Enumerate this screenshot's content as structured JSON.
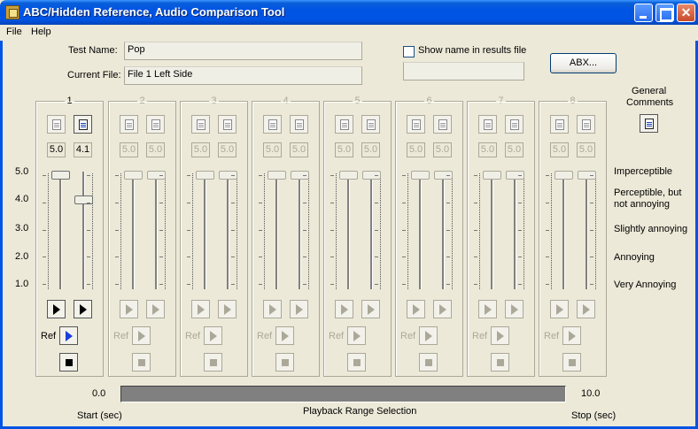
{
  "window": {
    "title": "ABC/Hidden Reference, Audio Comparison Tool"
  },
  "menu": {
    "file": "File",
    "help": "Help"
  },
  "form": {
    "test_name_label": "Test Name:",
    "test_name_value": "Pop",
    "current_file_label": "Current File:",
    "current_file_value": "File 1 Left Side",
    "show_name_label": "Show name in results file",
    "abx_label": "ABX..."
  },
  "general_comments": {
    "line1": "General",
    "line2": "Comments"
  },
  "scale": {
    "ticks": [
      "5.0",
      "4.0",
      "3.0",
      "2.0",
      "1.0"
    ],
    "descriptions": {
      "imperceptible": "Imperceptible",
      "perceptible_1": "Perceptible, but",
      "perceptible_2": "not annoying",
      "slightly": "Slightly annoying",
      "annoying": "Annoying",
      "very": "Very Annoying"
    }
  },
  "channels": [
    {
      "number": "1",
      "enabled": true,
      "ref_label": "Ref",
      "left_value": "5.0",
      "right_value": "4.1",
      "left_rating": 5.0,
      "right_rating": 4.1
    },
    {
      "number": "2",
      "enabled": false,
      "ref_label": "Ref",
      "left_value": "5.0",
      "right_value": "5.0",
      "left_rating": 5.0,
      "right_rating": 5.0
    },
    {
      "number": "3",
      "enabled": false,
      "ref_label": "Ref",
      "left_value": "5.0",
      "right_value": "5.0",
      "left_rating": 5.0,
      "right_rating": 5.0
    },
    {
      "number": "4",
      "enabled": false,
      "ref_label": "Ref",
      "left_value": "5.0",
      "right_value": "5.0",
      "left_rating": 5.0,
      "right_rating": 5.0
    },
    {
      "number": "5",
      "enabled": false,
      "ref_label": "Ref",
      "left_value": "5.0",
      "right_value": "5.0",
      "left_rating": 5.0,
      "right_rating": 5.0
    },
    {
      "number": "6",
      "enabled": false,
      "ref_label": "Ref",
      "left_value": "5.0",
      "right_value": "5.0",
      "left_rating": 5.0,
      "right_rating": 5.0
    },
    {
      "number": "7",
      "enabled": false,
      "ref_label": "Ref",
      "left_value": "5.0",
      "right_value": "5.0",
      "left_rating": 5.0,
      "right_rating": 5.0
    },
    {
      "number": "8",
      "enabled": false,
      "ref_label": "Ref",
      "left_value": "5.0",
      "right_value": "5.0",
      "left_rating": 5.0,
      "right_rating": 5.0
    }
  ],
  "playback": {
    "start_value": "0.0",
    "end_value": "10.0",
    "start_label": "Start (sec)",
    "title": "Playback Range Selection",
    "stop_label": "Stop (sec)"
  }
}
